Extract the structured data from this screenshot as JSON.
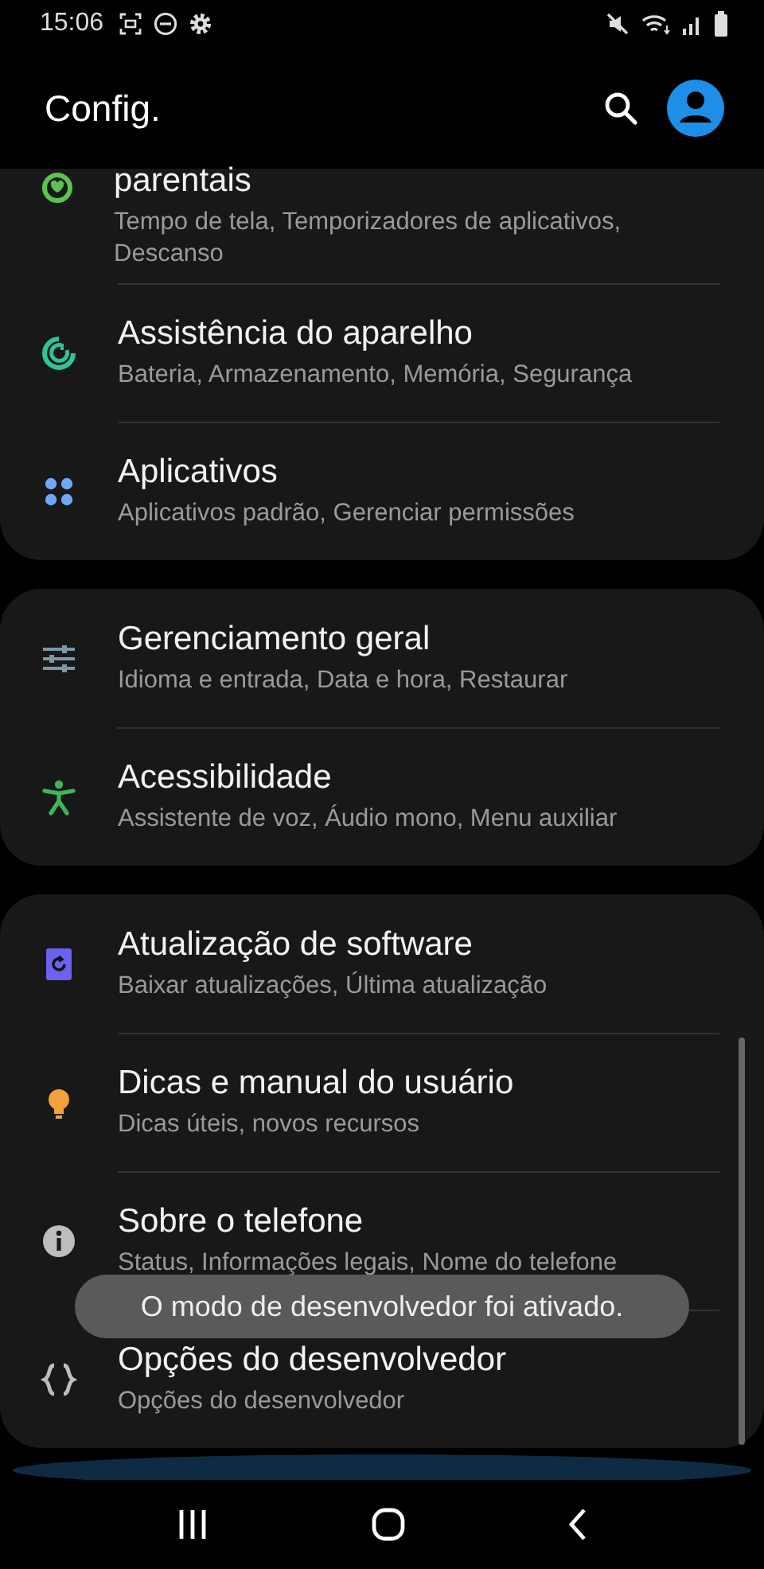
{
  "status_bar": {
    "time": "15:06"
  },
  "app_bar": {
    "title": "Config."
  },
  "groups": [
    {
      "items": [
        {
          "title": "parentais",
          "subtitle": "Tempo de tela, Temporizadores de aplicativos, Descanso"
        },
        {
          "title": "Assistência do aparelho",
          "subtitle": "Bateria, Armazenamento, Memória, Segurança"
        },
        {
          "title": "Aplicativos",
          "subtitle": "Aplicativos padrão, Gerenciar permissões"
        }
      ]
    },
    {
      "items": [
        {
          "title": "Gerenciamento geral",
          "subtitle": "Idioma e entrada, Data e hora, Restaurar"
        },
        {
          "title": "Acessibilidade",
          "subtitle": "Assistente de voz, Áudio mono, Menu auxiliar"
        }
      ]
    },
    {
      "items": [
        {
          "title": "Atualização de software",
          "subtitle": "Baixar atualizações, Última atualização"
        },
        {
          "title": "Dicas e manual do usuário",
          "subtitle": "Dicas úteis, novos recursos"
        },
        {
          "title": "Sobre o telefone",
          "subtitle": "Status, Informações legais, Nome do telefone"
        },
        {
          "title": "Opções do desenvolvedor",
          "subtitle": "Opções do desenvolvedor"
        }
      ]
    }
  ],
  "toast": {
    "message": "O modo de desenvolvedor foi ativado."
  }
}
